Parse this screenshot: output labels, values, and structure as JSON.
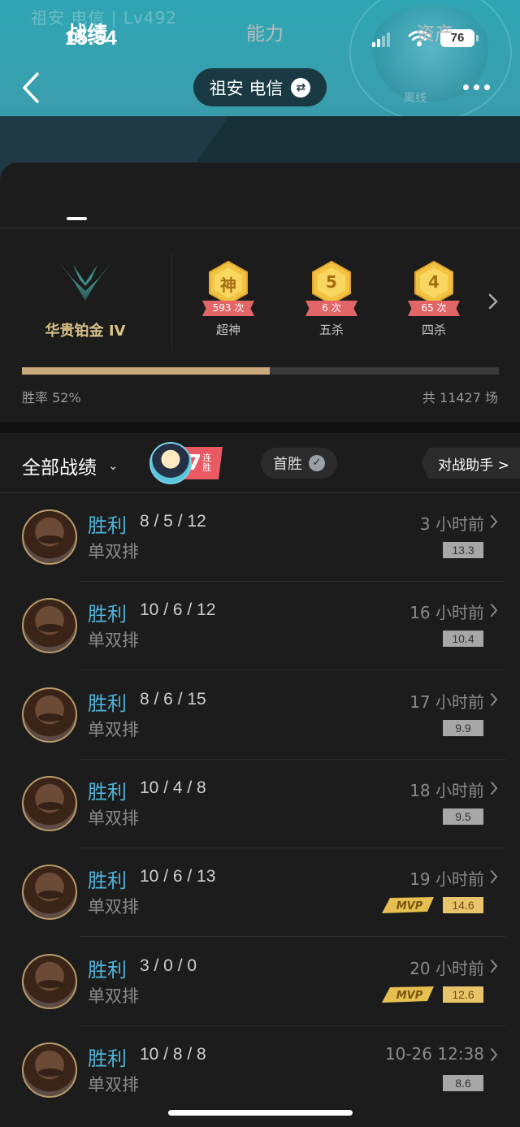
{
  "header": {
    "background_name": "祖安 电信 | Lv492",
    "server_label": "祖安 电信",
    "status_text": "离线"
  },
  "status_bar": {
    "time": "15:54",
    "battery": "76"
  },
  "tabs": [
    {
      "label": "战绩",
      "active": true
    },
    {
      "label": "能力",
      "active": false
    },
    {
      "label": "资产",
      "active": false
    }
  ],
  "rank": {
    "name": "华贵铂金 IV"
  },
  "medals": [
    {
      "glyph": "神",
      "count": "593 次",
      "label": "超神"
    },
    {
      "glyph": "5",
      "count": "6 次",
      "label": "五杀"
    },
    {
      "glyph": "4",
      "count": "65 次",
      "label": "四杀"
    }
  ],
  "summary": {
    "win_rate_text": "胜率 52%",
    "win_rate_value": 0.52,
    "total_text": "共 11427 场"
  },
  "filter": {
    "label": "全部战绩",
    "streak_number": "7",
    "streak_text": "连胜",
    "first_win_label": "首胜",
    "assistant_label": "对战助手 >"
  },
  "matches": [
    {
      "result": "胜利",
      "kda": "8 / 5 / 12",
      "mode": "单双排",
      "time": "3 小时前",
      "score": "13.3",
      "mvp": false
    },
    {
      "result": "胜利",
      "kda": "10 / 6 / 12",
      "mode": "单双排",
      "time": "16 小时前",
      "score": "10.4",
      "mvp": false
    },
    {
      "result": "胜利",
      "kda": "8 / 6 / 15",
      "mode": "单双排",
      "time": "17 小时前",
      "score": "9.9",
      "mvp": false
    },
    {
      "result": "胜利",
      "kda": "10 / 4 / 8",
      "mode": "单双排",
      "time": "18 小时前",
      "score": "9.5",
      "mvp": false
    },
    {
      "result": "胜利",
      "kda": "10 / 6 / 13",
      "mode": "单双排",
      "time": "19 小时前",
      "score": "14.6",
      "mvp": true
    },
    {
      "result": "胜利",
      "kda": "3 / 0 / 0",
      "mode": "单双排",
      "time": "20 小时前",
      "score": "12.6",
      "mvp": true
    },
    {
      "result": "胜利",
      "kda": "10 / 8 / 8",
      "mode": "单双排",
      "time": "10-26 12:38",
      "score": "8.6",
      "mvp": false
    }
  ],
  "colors": {
    "win": "#4fb4d8",
    "rank_gold": "#d9c189",
    "progress": "#c9a97a",
    "mvp_gold": "#e8c46a"
  }
}
